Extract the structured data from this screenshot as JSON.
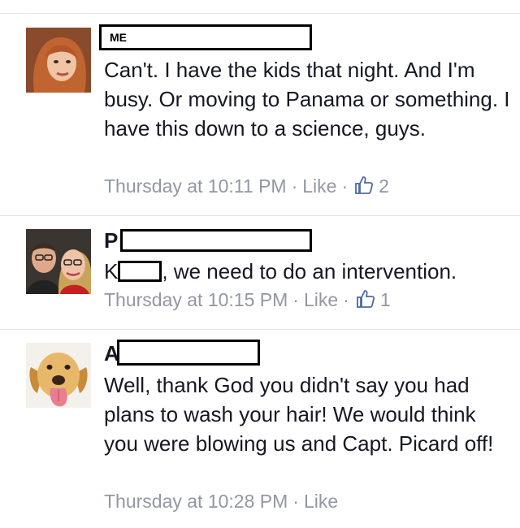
{
  "comments": [
    {
      "author_label": "ME",
      "text": "Can't. I have the kids that night. And I'm busy. Or moving to Panama or something. I have this down to a science, guys.",
      "timestamp": "Thursday at 10:11 PM",
      "like_label": "Like",
      "like_count": "2",
      "avatar_icon": "woman-red-hair-avatar"
    },
    {
      "author_initial": "P",
      "text_prefix": "K",
      "text_suffix": ", we need to do an intervention.",
      "timestamp": "Thursday at 10:15 PM",
      "like_label": "Like",
      "like_count": "1",
      "avatar_icon": "couple-selfie-avatar"
    },
    {
      "author_initial": "A",
      "text": "Well, thank God you didn't say you had plans to wash your hair!  We would think you were blowing us and Capt. Picard off!",
      "timestamp": "Thursday at 10:28 PM",
      "like_label": "Like",
      "avatar_icon": "dog-tongue-avatar"
    }
  ],
  "colors": {
    "text": "#141823",
    "meta": "#9197a3",
    "thumb": "#4e69a2",
    "divider": "#e5e5e8"
  }
}
